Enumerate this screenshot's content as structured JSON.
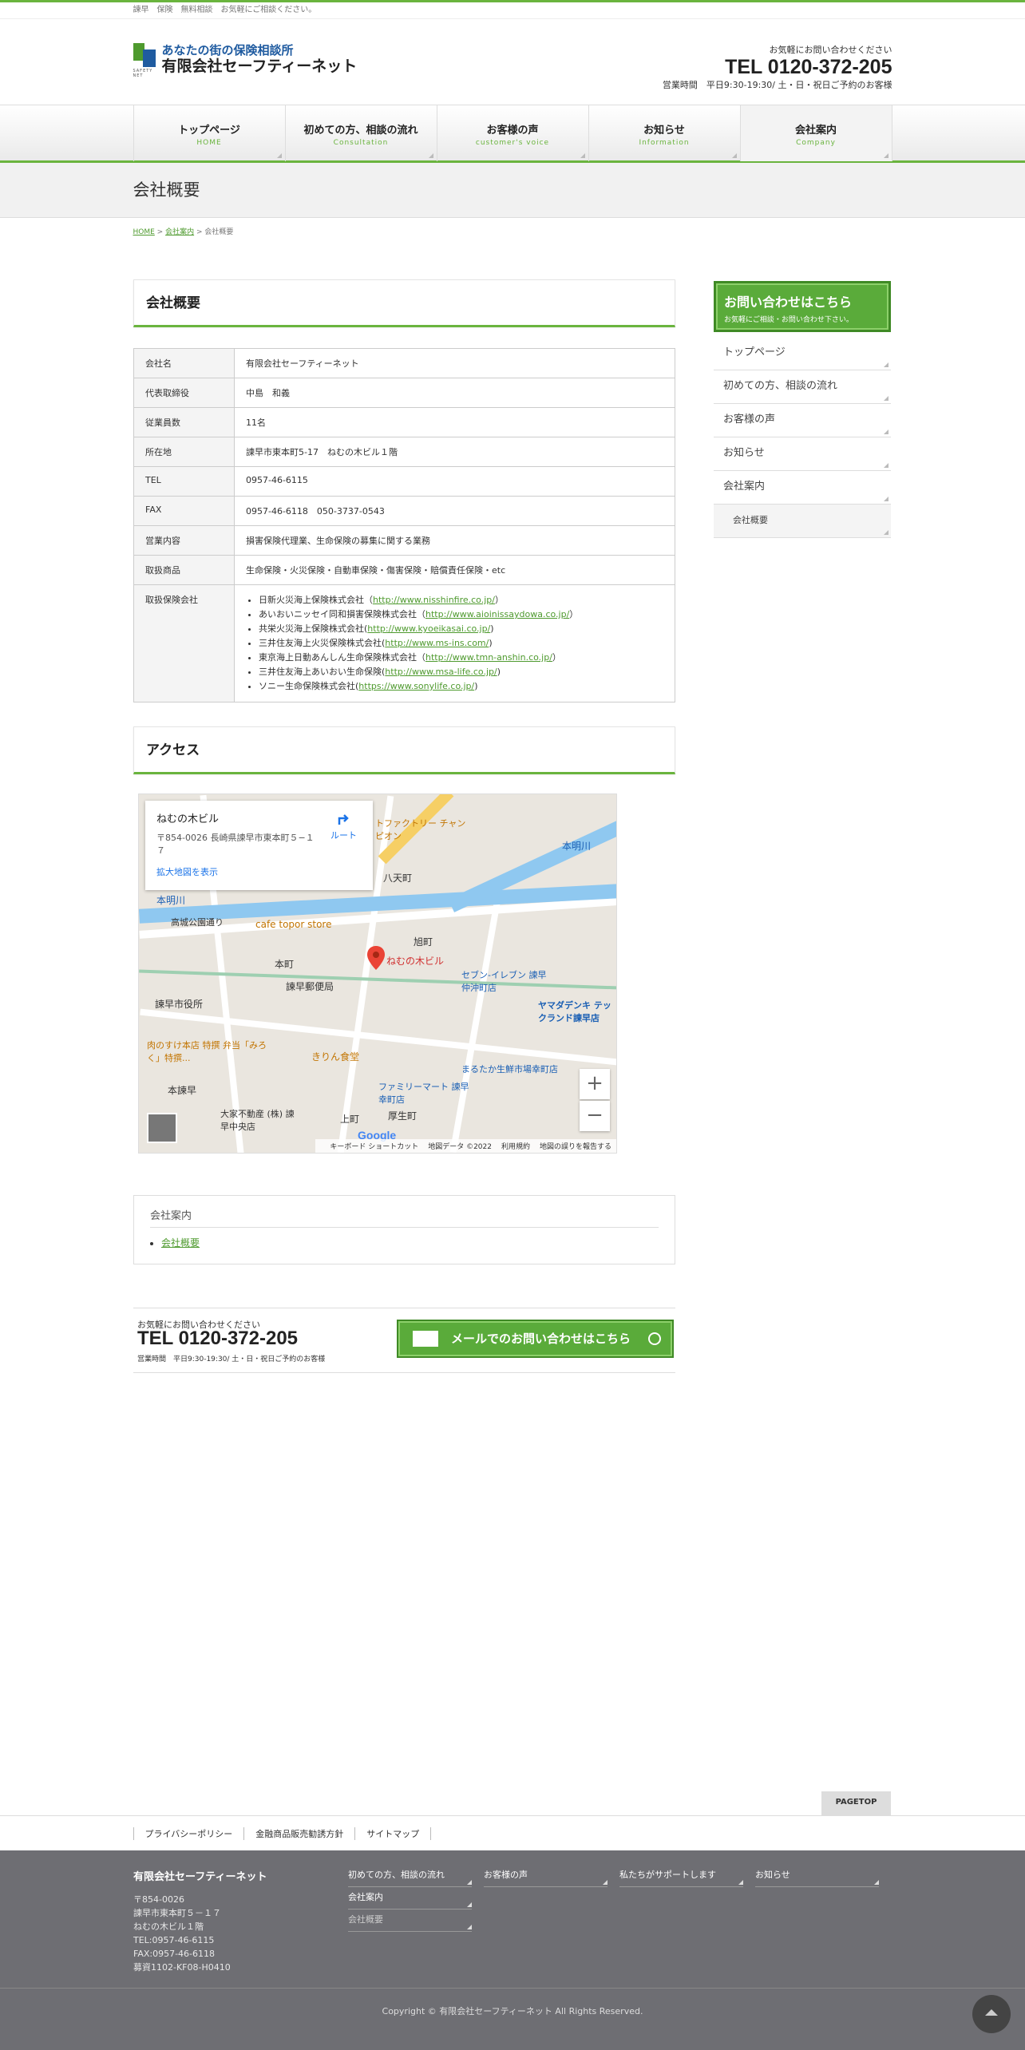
{
  "topbar": {
    "text": "諫早　保険　無料相談　お気軽にご相談ください。"
  },
  "logo": {
    "line1": "あなたの街の保険相談所",
    "line2": "有限会社セーフティーネット",
    "mark_text": "SAFETY NET"
  },
  "header_contact": {
    "lead": "お気軽にお問い合わせください",
    "tel": "TEL 0120-372-205",
    "hours": "営業時間　平日9:30-19:30/ 土・日・祝日ご予約のお客様"
  },
  "gnav": [
    {
      "jp": "トップページ",
      "en": "HOME"
    },
    {
      "jp": "初めての方、相談の流れ",
      "en": "Consultation"
    },
    {
      "jp": "お客様の声",
      "en": "customer's voice"
    },
    {
      "jp": "お知らせ",
      "en": "Information"
    },
    {
      "jp": "会社案内",
      "en": "Company"
    }
  ],
  "page_title": "会社概要",
  "breadcrumb": {
    "home": "HOME",
    "sep": " > ",
    "parent": "会社案内",
    "current": "会社概要"
  },
  "company_section": {
    "heading": "会社概要"
  },
  "table": [
    {
      "label": "会社名",
      "value": "有限会社セーフティーネット"
    },
    {
      "label": "代表取締役",
      "value": "中島　和義"
    },
    {
      "label": "従業員数",
      "value": "11名"
    },
    {
      "label": "所在地",
      "value": "諫早市東本町5-17　ねむの木ビル１階"
    },
    {
      "label": "TEL",
      "value": "0957-46-6115"
    },
    {
      "label": "FAX",
      "value": "0957-46-6118　050-3737-0543"
    },
    {
      "label": "営業内容",
      "value": "損害保険代理業、生命保険の募集に関する業務"
    },
    {
      "label": "取扱商品",
      "value": "生命保険・火災保険・自動車保険・傷害保険・賠償責任保険・etc"
    }
  ],
  "insurers": {
    "label": "取扱保険会社",
    "items": [
      {
        "name": "日新火災海上保険株式会社（",
        "url": "http://www.nisshinfire.co.jp/",
        "close": "）"
      },
      {
        "name": "あいおいニッセイ同和損害保険株式会社（",
        "url": "http://www.aioinissaydowa.co.jp/",
        "close": "）"
      },
      {
        "name": "共栄火災海上保険株式会社(",
        "url": "http://www.kyoeikasai.co.jp/",
        "close": ")"
      },
      {
        "name": "三井住友海上火災保険株式会社(",
        "url": "http://www.ms-ins.com/",
        "close": ")"
      },
      {
        "name": "東京海上日動あんしん生命保険株式会社（",
        "url": "http://www.tmn-anshin.co.jp/",
        "close": "）"
      },
      {
        "name": "三井住友海上あいおい生命保険(",
        "url": "http://www.msa-life.co.jp/",
        "close": ")"
      },
      {
        "name": "ソニー生命保険株式会社(",
        "url": "https://www.sonylife.co.jp/",
        "close": ")"
      }
    ]
  },
  "access": {
    "heading": "アクセス"
  },
  "map": {
    "place_title": "ねむの木ビル",
    "address": "〒854-0026 長崎県諫早市東本町５−１７",
    "enlarge": "拡大地図を表示",
    "route": "ルート",
    "pin_label": "ねむの木ビル",
    "labels": {
      "hattencho": "八天町",
      "honmyo_river_r": "本明川",
      "honmyo_river_l": "本明川",
      "factory": "トファクトリー チャンピオン",
      "kosai": "高城公園通り",
      "cafe": "cafe topor store",
      "asahi": "旭町",
      "honmachi": "本町",
      "post": "諫早郵便局",
      "seven": "セブン-イレブン 諫早仲沖町店",
      "city_hall": "諫早市役所",
      "yamada": "ヤマダデンキ テックランド諫早店",
      "marutaka": "まるたか生鮮市場幸町店",
      "meat": "肉のすけ本店 特撰 弁当「みろく」特撰...",
      "kirin": "きりん食堂",
      "family": "ファミリーマート 諫早幸町店",
      "isahaya_stn": "本諫早",
      "daika": "大家不動産 (株) 諫早中央店",
      "kamimachi": "上町",
      "atsuseicho": "厚生町"
    },
    "zoom_in": "+",
    "zoom_out": "−",
    "google": "Google",
    "footer": {
      "shortcuts": "キーボード ショートカット",
      "data": "地図データ ©2022",
      "terms": "利用規約",
      "report": "地図の誤りを報告する"
    }
  },
  "subnav": {
    "heading": "会社案内",
    "item": "会社概要"
  },
  "contact_box": {
    "lead": "お気軽にお問い合わせください",
    "tel": "TEL 0120-372-205",
    "hours": "営業時間　平日9:30-19:30/ 土・日・祝日ご予約のお客様",
    "mail_button": "メールでのお問い合わせはこちら"
  },
  "side": {
    "cta_main": "お問い合わせはこちら",
    "cta_sub": "お気軽にご相談・お問い合わせ下さい。",
    "menu": [
      "トップページ",
      "初めての方、相談の流れ",
      "お客様の声",
      "お知らせ",
      "会社案内"
    ],
    "submenu": "会社概要"
  },
  "pagetop": "PAGETOP",
  "footer_nav": [
    "プライバシーポリシー",
    "金融商品販売勧誘方針",
    "サイトマップ"
  ],
  "footer": {
    "company": "有限会社セーフティーネット",
    "lines": [
      "〒854-0026",
      "諫早市東本町５－１７",
      "ねむの木ビル１階",
      "TEL:0957-46-6115",
      "FAX:0957-46-6118",
      "募資1102-KF08-H0410"
    ],
    "links": [
      "初めての方、相談の流れ",
      "お客様の声",
      "私たちがサポートします",
      "お知らせ",
      "会社案内",
      "会社概要"
    ],
    "copyright": "Copyright © 有限会社セーフティーネット All Rights Reserved."
  },
  "colors": {
    "accent": "#6ab43e",
    "button": "#5aab3a",
    "footer_bg": "#6e6e73",
    "link": "#4e9a2e"
  }
}
